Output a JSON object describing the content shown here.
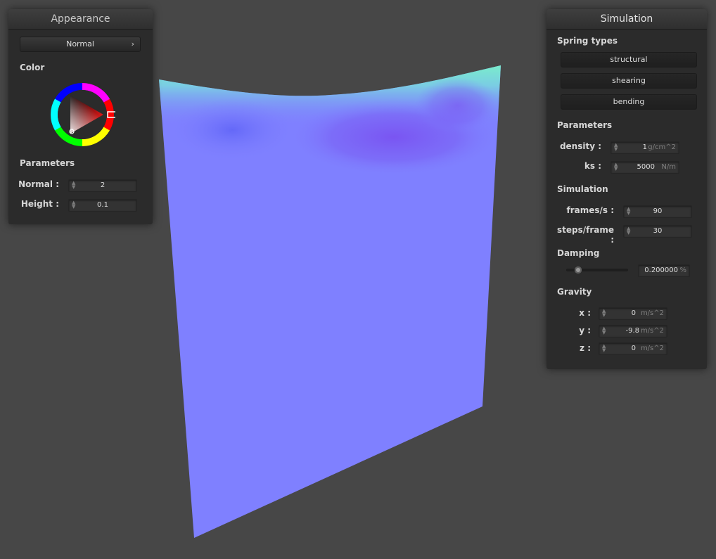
{
  "appearance": {
    "title": "Appearance",
    "shader_value": "Normal",
    "color_label": "Color",
    "params_label": "Parameters",
    "normal_label": "Normal :",
    "normal_value": "2",
    "height_label": "Height :",
    "height_value": "0.1"
  },
  "simulation": {
    "title": "Simulation",
    "spring_types_label": "Spring types",
    "springs": [
      "structural",
      "shearing",
      "bending"
    ],
    "params_label": "Parameters",
    "density_label": "density :",
    "density_value": "1",
    "density_unit": "g/cm^2",
    "ks_label": "ks :",
    "ks_value": "5000",
    "ks_unit": "N/m",
    "sim_label": "Simulation",
    "fps_label": "frames/s :",
    "fps_value": "90",
    "steps_label": "steps/frame :",
    "steps_value": "30",
    "damping_label": "Damping",
    "damping_value": "0.200000",
    "damping_unit": "%",
    "damping_slider_fraction": 0.2,
    "gravity_label": "Gravity",
    "gx_label": "x :",
    "gx_value": "0",
    "gy_label": "y :",
    "gy_value": "-9.8",
    "gz_label": "z :",
    "gz_value": "0",
    "gravity_unit": "m/s^2"
  },
  "colors": {
    "background": "#474747",
    "cloth": "#7f80ff",
    "panel": "#2b2b2b"
  }
}
